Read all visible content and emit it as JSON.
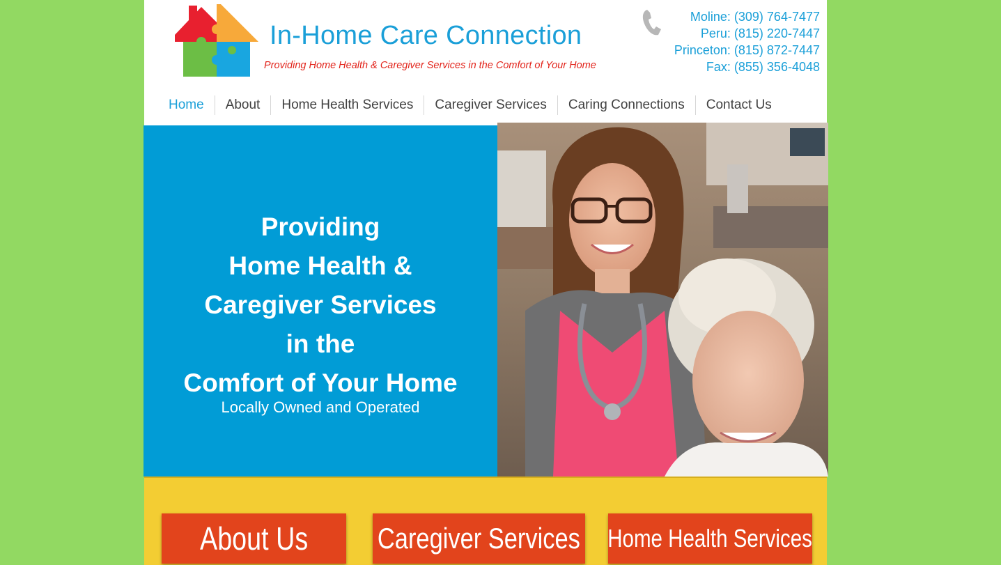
{
  "header": {
    "site_title": "In-Home Care Connection",
    "tagline": "Providing Home Health & Caregiver Services in the Comfort of Your Home",
    "contacts": [
      "Moline: (309) 764-7477",
      "Peru: (815) 220-7447",
      "Princeton: (815) 872-7447",
      "Fax: (855) 356-4048"
    ],
    "icons": {
      "logo": "puzzle-house-logo",
      "phone": "phone-icon"
    }
  },
  "nav": {
    "items": [
      "Home",
      "About",
      "Home Health Services",
      "Caregiver Services",
      "Caring Connections",
      "Contact Us"
    ],
    "active": "Home"
  },
  "hero": {
    "lines": [
      "Providing",
      "Home Health &",
      "Caregiver Services",
      "in the",
      "Comfort of Your Home"
    ],
    "subtitle": "Locally Owned and Operated"
  },
  "cta": {
    "buttons": [
      "About Us",
      "Caregiver Services",
      "Home Health Services"
    ]
  },
  "colors": {
    "background": "#92d962",
    "accent_blue": "#1a9fd8",
    "hero_blue": "#019cd6",
    "tagline_red": "#e2231a",
    "yellow": "#f3cd33",
    "button_orange": "#e2441c"
  }
}
